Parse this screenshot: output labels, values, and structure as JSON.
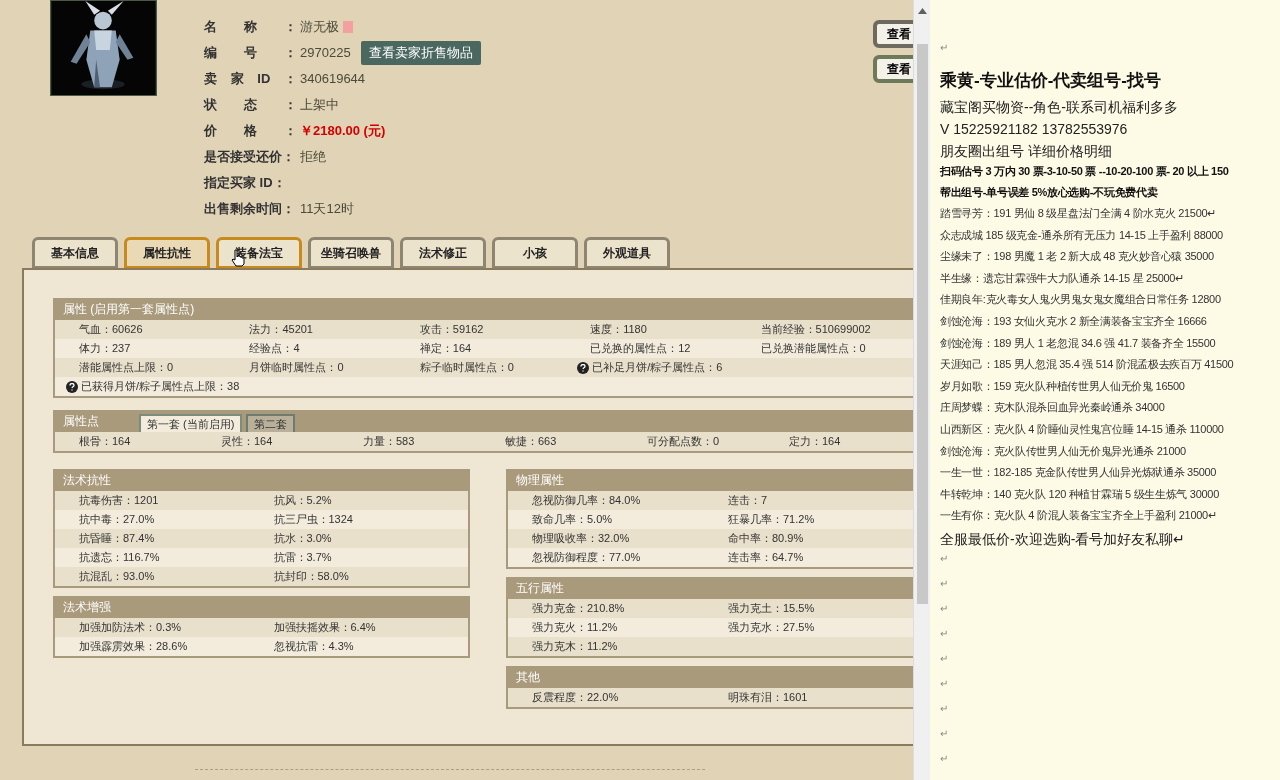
{
  "info": [
    {
      "label": "名称：",
      "value": "游无极",
      "kind": "name",
      "justify": true
    },
    {
      "label": "编号：",
      "value": "2970225",
      "kind": "id",
      "justify": true,
      "button": "查看卖家折售物品"
    },
    {
      "label": "卖家ID：",
      "value": "340619644",
      "kind": "plain",
      "justify": true
    },
    {
      "label": "状态：",
      "value": "上架中",
      "kind": "plain",
      "justify": true
    },
    {
      "label": "价格：",
      "value": "￥2180.00 (元)",
      "kind": "price",
      "justify": true
    },
    {
      "label": "是否接受还价：",
      "value": "拒绝",
      "kind": "plain",
      "justify": false
    },
    {
      "label": "指定买家 ID：",
      "kind": "plain",
      "justify": false
    },
    {
      "label": "出售剩余时间：",
      "value": "11天12时",
      "kind": "plain",
      "justify": false
    }
  ],
  "side_buttons": [
    "查看",
    "查看"
  ],
  "tabs": [
    {
      "label": "基本信息",
      "selected": false,
      "hovered": false
    },
    {
      "label": "属性抗性",
      "selected": true,
      "hovered": false
    },
    {
      "label": "装备法宝",
      "selected": false,
      "hovered": true
    },
    {
      "label": "坐骑召唤兽",
      "selected": false,
      "hovered": false
    },
    {
      "label": "法术修正",
      "selected": false,
      "hovered": false
    },
    {
      "label": "小孩",
      "selected": false,
      "hovered": false
    },
    {
      "label": "外观道具",
      "selected": false,
      "hovered": false
    }
  ],
  "full_sections": [
    {
      "title": "属性 (启用第一套属性点)",
      "rows": [
        [
          {
            "text": "气血：60626"
          },
          {
            "text": "法力：45201"
          },
          {
            "text": "攻击：59162"
          },
          {
            "text": "速度：1180"
          },
          {
            "text": "当前经验：510699002"
          }
        ],
        [
          {
            "text": "体力：237"
          },
          {
            "text": "经验点：4"
          },
          {
            "text": "禅定：164"
          },
          {
            "text": "已兑换的属性点：12"
          },
          {
            "text": "已兑换潜能属性点：0"
          }
        ],
        [
          {
            "text": "潜能属性点上限：0"
          },
          {
            "text": "月饼临时属性点：0"
          },
          {
            "text": "粽子临时属性点：0"
          },
          {
            "text": "已补足月饼/粽子属性点：6",
            "help": true
          }
        ],
        [
          {
            "text": "已获得月饼/粽子属性点上限：38",
            "help": true
          }
        ]
      ]
    },
    {
      "title": "属性点",
      "subtabs": [
        {
          "label": "第一套 (当前启用)",
          "selected": true
        },
        {
          "label": "第二套",
          "selected": false
        }
      ],
      "rows": [
        [
          {
            "text": "根骨：164"
          },
          {
            "text": "灵性：164"
          },
          {
            "text": "力量：583"
          },
          {
            "text": "敏捷：663"
          },
          {
            "text": "可分配点数：0"
          },
          {
            "text": "定力：164"
          }
        ]
      ]
    }
  ],
  "left_sections": [
    {
      "title": "法术抗性",
      "rows": [
        [
          {
            "text": "抗毒伤害：1201"
          },
          {
            "text": "抗风：5.2%"
          }
        ],
        [
          {
            "text": "抗中毒：27.0%"
          },
          {
            "text": "抗三尸虫：1324"
          }
        ],
        [
          {
            "text": "抗昏睡：87.4%"
          },
          {
            "text": "抗水：3.0%"
          }
        ],
        [
          {
            "text": "抗遗忘：116.7%"
          },
          {
            "text": "抗雷：3.7%"
          }
        ],
        [
          {
            "text": "抗混乱：93.0%"
          },
          {
            "text": "抗封印：58.0%"
          }
        ]
      ]
    },
    {
      "title": "法术增强",
      "rows": [
        [
          {
            "text": "加强加防法术：0.3%"
          },
          {
            "text": "加强扶摇效果：6.4%"
          }
        ],
        [
          {
            "text": "加强霹雳效果：28.6%"
          },
          {
            "text": "忽视抗雷：4.3%"
          }
        ]
      ]
    }
  ],
  "right_sections": [
    {
      "title": "物理属性",
      "rows": [
        [
          {
            "text": "忽视防御几率：84.0%"
          },
          {
            "text": "连击：7"
          }
        ],
        [
          {
            "text": "致命几率：5.0%"
          },
          {
            "text": "狂暴几率：71.2%"
          }
        ],
        [
          {
            "text": "物理吸收率：32.0%"
          },
          {
            "text": "命中率：80.9%"
          }
        ],
        [
          {
            "text": "忽视防御程度：77.0%"
          },
          {
            "text": "连击率：64.7%"
          }
        ]
      ]
    },
    {
      "title": "五行属性",
      "rows": [
        [
          {
            "text": "强力克金：210.8%"
          },
          {
            "text": "强力克土：15.5%"
          }
        ],
        [
          {
            "text": "强力克火：11.2%"
          },
          {
            "text": "强力克水：27.5%"
          }
        ],
        [
          {
            "text": "强力克木：11.2%"
          }
        ]
      ]
    },
    {
      "title": "其他",
      "rows": [
        [
          {
            "text": "反震程度：22.0%"
          },
          {
            "text": "明珠有泪：1601"
          }
        ]
      ]
    }
  ],
  "document": [
    {
      "kind": "mark",
      "text": "↵"
    },
    {
      "kind": "title",
      "text": "乘黄-专业估价-代卖组号-找号"
    },
    {
      "kind": "large",
      "text": "藏宝阁买物资--角色-联系司机福利多多"
    },
    {
      "kind": "large",
      "text": "V 15225921182    13782553976"
    },
    {
      "kind": "large",
      "text": "朋友圈出组号    详细价格明细"
    },
    {
      "kind": "bold",
      "text": "扫码估号 3 万内 30 票-3-10-50 票  --10-20-100 票- 20 以上 150"
    },
    {
      "kind": "bold",
      "text": "帮出组号-单号误差 5%放心选购-不玩免费代卖"
    },
    {
      "kind": "normal",
      "text": "踏雪寻芳：191 男仙 8 级星盘法门全满 4 阶水克火 21500↵"
    },
    {
      "kind": "normal",
      "text": "众志成城  185 级克金-通杀所有无压力 14-15 上手盈利 88000"
    },
    {
      "kind": "normal",
      "text": "尘缘未了：198 男魔 1 老 2 新大成 48 克火妙音心猿 35000"
    },
    {
      "kind": "normal",
      "text": "半生缘：遗忘甘霖强牛大力队通杀 14-15 星 25000↵"
    },
    {
      "kind": "normal",
      "text": "佳期良年:克火毒女人鬼火男鬼女鬼女魔组合日常任务 12800"
    },
    {
      "kind": "normal",
      "text": "剑蚀沧海：193 女仙火克水 2 新全满装备宝宝齐全 16666"
    },
    {
      "kind": "normal",
      "text": "剑蚀沧海：189 男人 1 老忽混 34.6 强 41.7 装备齐全 15500"
    },
    {
      "kind": "normal",
      "text": "天涯知己：185 男人忽混 35.4 强 514 阶混孟极去疾百万 41500"
    },
    {
      "kind": "normal",
      "text": "岁月如歌：159 克火队种植传世男人仙无价鬼 16500"
    },
    {
      "kind": "normal",
      "text": "庄周梦蝶：克木队混杀回血异光秦岭通杀 34000"
    },
    {
      "kind": "normal",
      "text": "山西新区：克火队 4 阶睡仙灵性鬼宫位睡 14-15 通杀 110000"
    },
    {
      "kind": "normal",
      "text": "剑蚀沧海：克火队传世男人仙无价鬼异光通杀 21000"
    },
    {
      "kind": "normal",
      "text": "一生一世：182-185 克金队传世男人仙异光炼狱通杀 35000"
    },
    {
      "kind": "normal",
      "text": "牛转乾坤：140 克火队 120 种植甘霖瑞 5 级生生炼气 30000"
    },
    {
      "kind": "normal",
      "text": "一生有你：克火队 4 阶混人装备宝宝齐全上手盈利 21000↵"
    },
    {
      "kind": "large",
      "text": "全服最低价-欢迎选购-看号加好友私聊↵"
    },
    {
      "kind": "mark",
      "text": "↵"
    },
    {
      "kind": "mark",
      "text": "↵"
    },
    {
      "kind": "mark",
      "text": "↵"
    },
    {
      "kind": "mark",
      "text": "↵"
    },
    {
      "kind": "mark",
      "text": "↵"
    },
    {
      "kind": "mark",
      "text": "↵"
    },
    {
      "kind": "mark",
      "text": "↵"
    },
    {
      "kind": "mark",
      "text": "↵"
    },
    {
      "kind": "mark",
      "text": "↵"
    }
  ]
}
